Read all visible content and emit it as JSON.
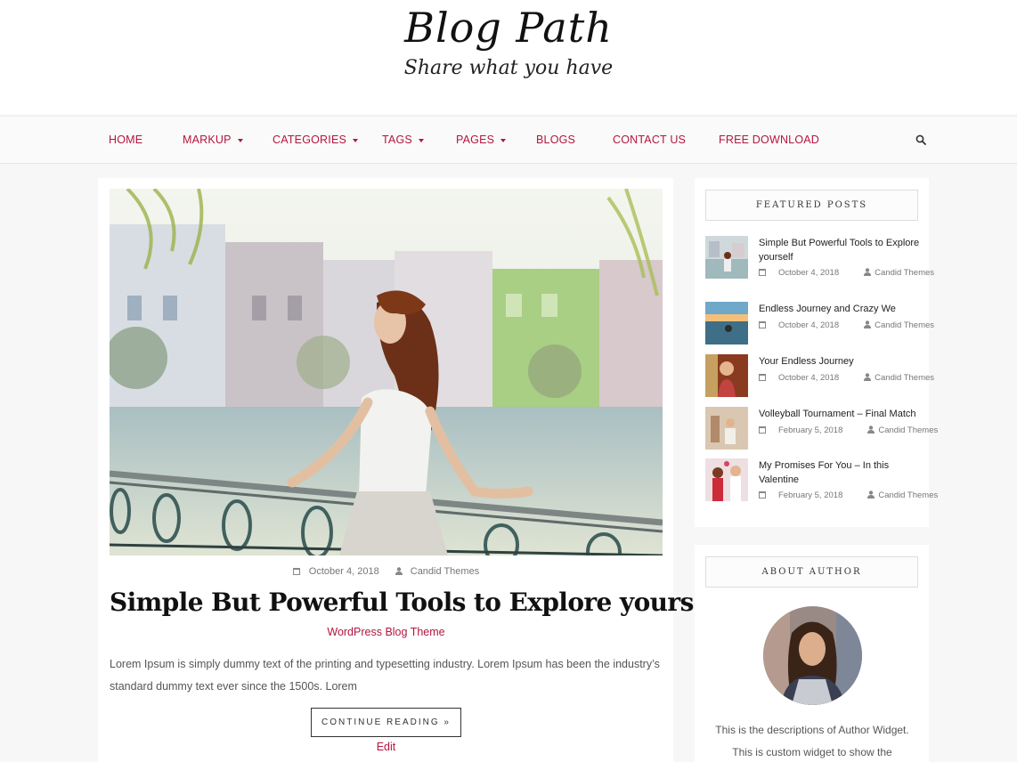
{
  "site": {
    "title": "Blog Path",
    "tagline": "Share what you have"
  },
  "nav": {
    "items": [
      {
        "label": "HOME",
        "has_dropdown": false
      },
      {
        "label": "MARKUP",
        "has_dropdown": true
      },
      {
        "label": "CATEGORIES",
        "has_dropdown": true
      },
      {
        "label": "TAGS",
        "has_dropdown": true
      },
      {
        "label": "PAGES",
        "has_dropdown": true
      },
      {
        "label": "BLOGS",
        "has_dropdown": false
      },
      {
        "label": "CONTACT US",
        "has_dropdown": false
      },
      {
        "label": "FREE DOWNLOAD",
        "has_dropdown": false
      }
    ],
    "search_icon": "search-icon"
  },
  "post": {
    "date": "October 4, 2018",
    "author": "Candid Themes",
    "title": "Simple But Powerful Tools to Explore yourself",
    "category": "WordPress Blog Theme",
    "excerpt": "Lorem Ipsum is simply dummy text of the printing and typesetting industry. Lorem Ipsum has been the industry’s standard dummy text ever since the 1500s. Lorem",
    "continue_label": "CONTINUE READING »",
    "edit_label": "Edit"
  },
  "featured": {
    "title": "FEATURED POSTS",
    "items": [
      {
        "title": "Simple But Powerful Tools to Explore yourself",
        "date": "October 4, 2018",
        "author": "Candid Themes"
      },
      {
        "title": "Endless Journey and Crazy We",
        "date": "October 4, 2018",
        "author": "Candid Themes"
      },
      {
        "title": "Your Endless Journey",
        "date": "October 4, 2018",
        "author": "Candid Themes"
      },
      {
        "title": "Volleyball Tournament – Final Match",
        "date": "February 5, 2018",
        "author": "Candid Themes"
      },
      {
        "title": "My Promises For You – In this Valentine",
        "date": "February 5, 2018",
        "author": "Candid Themes"
      }
    ]
  },
  "about": {
    "title": "ABOUT AUTHOR",
    "description": "This is the descriptions of Author Widget. This is custom widget to show the"
  },
  "colors": {
    "accent": "#b3163e",
    "background": "#f7f7f7"
  }
}
